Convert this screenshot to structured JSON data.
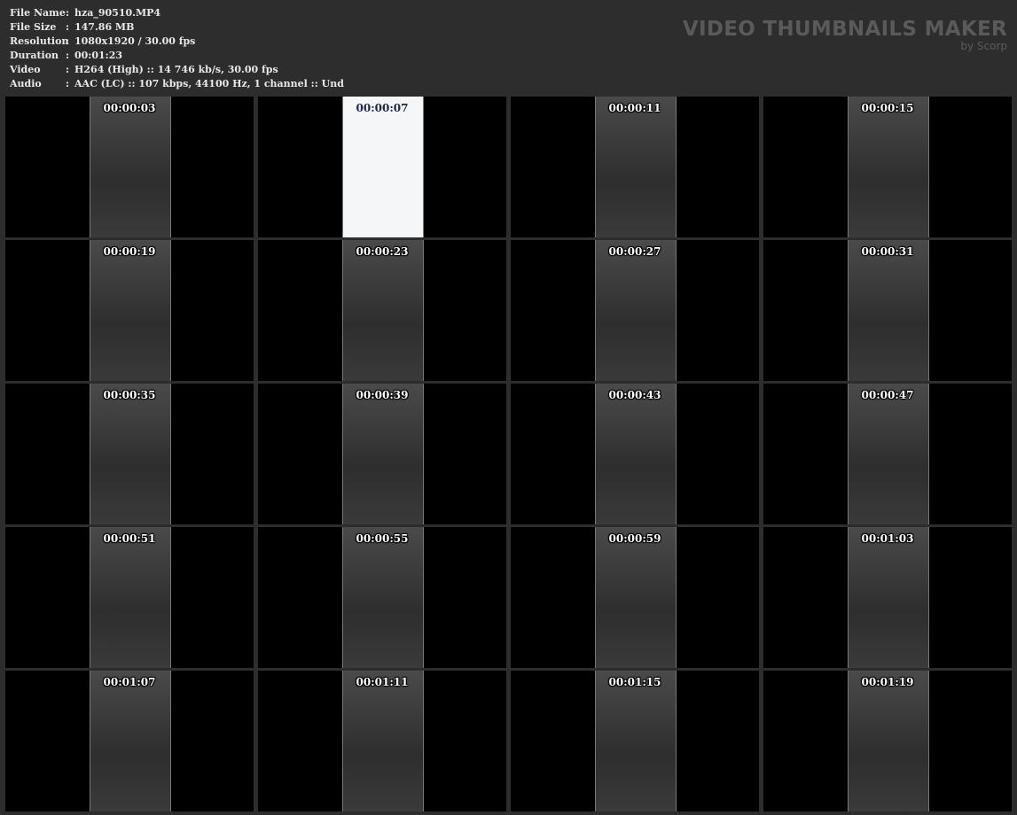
{
  "info": [
    {
      "key": "File Name",
      "value": "hza_90510.MP4"
    },
    {
      "key": "File Size",
      "value": "147.86 MB"
    },
    {
      "key": "Resolution",
      "value": "1080x1920 / 30.00 fps"
    },
    {
      "key": "Duration",
      "value": "00:01:23"
    },
    {
      "key": "Video",
      "value": "H264 (High) :: 14 746 kb/s, 30.00 fps"
    },
    {
      "key": "Audio",
      "value": "AAC (LC) :: 107 kbps, 44100 Hz, 1 channel :: Und"
    }
  ],
  "separator": ":",
  "brand": {
    "title": "VIDEO THUMBNAILS MAKER",
    "subtitle": "by Scorp"
  },
  "thumbnails": [
    "00:00:03",
    "00:00:07",
    "00:00:11",
    "00:00:15",
    "00:00:19",
    "00:00:23",
    "00:00:27",
    "00:00:31",
    "00:00:35",
    "00:00:39",
    "00:00:43",
    "00:00:47",
    "00:00:51",
    "00:00:55",
    "00:00:59",
    "00:01:03",
    "00:01:07",
    "00:01:11",
    "00:01:15",
    "00:01:19"
  ]
}
